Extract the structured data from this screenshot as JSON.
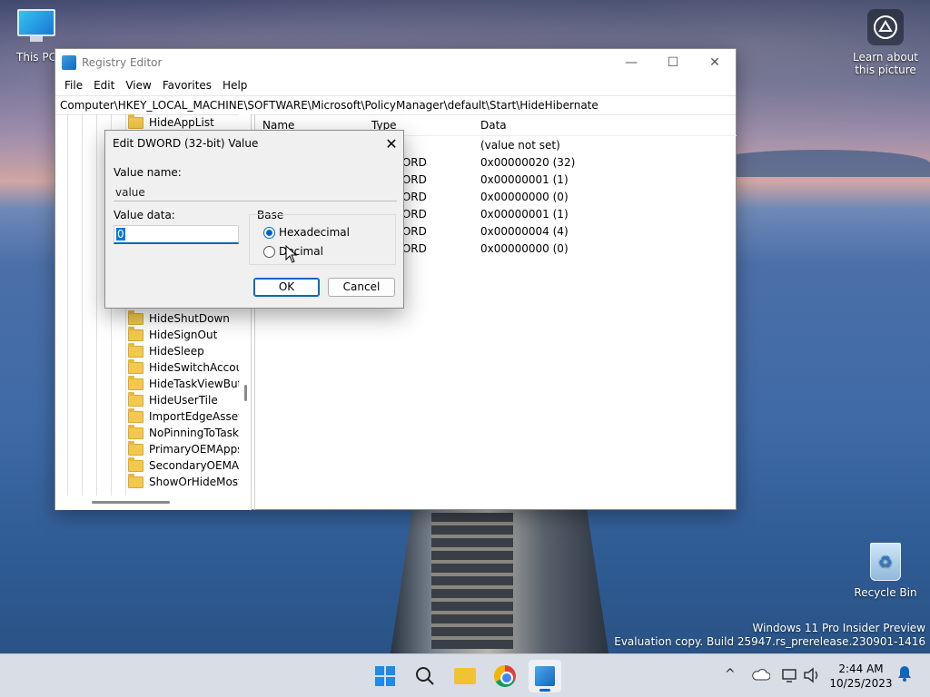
{
  "desktop": {
    "this_pc_label": "This PC",
    "learn_label": "Learn about this picture",
    "recycle_label": "Recycle Bin",
    "watermark_line1": "Windows 11 Pro Insider Preview",
    "watermark_line2": "Evaluation copy. Build 25947.rs_prerelease.230901-1416"
  },
  "window": {
    "title": "Registry Editor",
    "menu": [
      "File",
      "Edit",
      "View",
      "Favorites",
      "Help"
    ],
    "address": "Computer\\HKEY_LOCAL_MACHINE\\SOFTWARE\\Microsoft\\PolicyManager\\default\\Start\\HideHibernate",
    "minimize_glyph": "—",
    "maximize_glyph": "☐",
    "close_glyph": "✕"
  },
  "tree": {
    "items_top": [
      "HideAppList"
    ],
    "items": [
      "HideShutDown",
      "HideSignOut",
      "HideSleep",
      "HideSwitchAccou",
      "HideTaskViewButt",
      "HideUserTile",
      "ImportEdgeAssets",
      "NoPinningToTask",
      "PrimaryOEMApps",
      "SecondaryOEMAp",
      "ShowOrHideMost"
    ]
  },
  "list": {
    "headers": {
      "name": "Name",
      "type": "Type",
      "data": "Data"
    },
    "rows": [
      {
        "type": "",
        "data": "(value not set)"
      },
      {
        "type": "WORD",
        "data": "0x00000020 (32)"
      },
      {
        "type": "WORD",
        "data": "0x00000001 (1)"
      },
      {
        "type": "WORD",
        "data": "0x00000000 (0)"
      },
      {
        "type": "WORD",
        "data": "0x00000001 (1)"
      },
      {
        "type": "WORD",
        "data": "0x00000004 (4)"
      },
      {
        "type": "WORD",
        "data": "0x00000000 (0)"
      }
    ]
  },
  "dialog": {
    "title": "Edit DWORD (32-bit) Value",
    "close_glyph": "✕",
    "value_name_label": "Value name:",
    "value_name": "value",
    "value_data_label": "Value data:",
    "value_data": "0",
    "base_label": "Base",
    "hex_label": "Hexadecimal",
    "dec_label": "Decimal",
    "ok_label": "OK",
    "cancel_label": "Cancel"
  },
  "taskbar": {
    "time": "2:44 AM",
    "date": "10/25/2023",
    "tray_chevron": "^"
  },
  "colors": {
    "accent": "#0067c0",
    "folder": "#f2c94c"
  }
}
